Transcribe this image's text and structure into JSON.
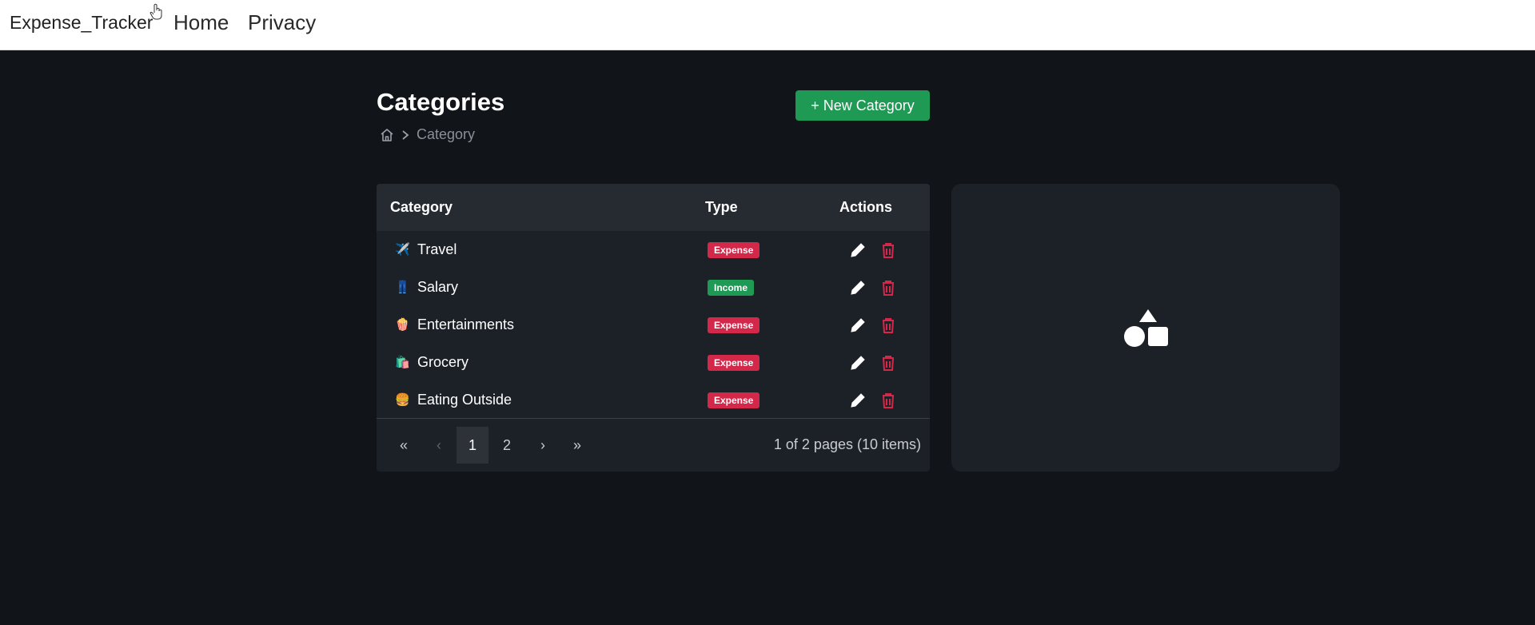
{
  "navbar": {
    "brand": "Expense_Tracker",
    "links": [
      {
        "label": "Home"
      },
      {
        "label": "Privacy"
      }
    ]
  },
  "page": {
    "title": "Categories",
    "breadcrumb": {
      "home_icon": "home-icon",
      "current": "Category"
    },
    "new_button_label": "+ New Category"
  },
  "table": {
    "columns": {
      "category": "Category",
      "type": "Type",
      "actions": "Actions"
    },
    "rows": [
      {
        "icon": "✈️",
        "name": "Travel",
        "type": "Expense"
      },
      {
        "icon": "👖",
        "name": "Salary",
        "type": "Income"
      },
      {
        "icon": "🍿",
        "name": "Entertainments",
        "type": "Expense"
      },
      {
        "icon": "🛍️",
        "name": "Grocery",
        "type": "Expense"
      },
      {
        "icon": "🍔",
        "name": "Eating Outside",
        "type": "Expense"
      }
    ],
    "pager": {
      "first": "«",
      "prev": "‹",
      "pages": [
        "1",
        "2"
      ],
      "current_page": "1",
      "next": "›",
      "last": "»",
      "info": "1 of 2 pages (10 items)"
    }
  },
  "colors": {
    "expense": "#d3284a",
    "income": "#1e9a55",
    "accent": "#1e9a55",
    "background": "#111419",
    "card": "#1c2128"
  },
  "side_panel": {
    "icon": "shapes-icon"
  }
}
